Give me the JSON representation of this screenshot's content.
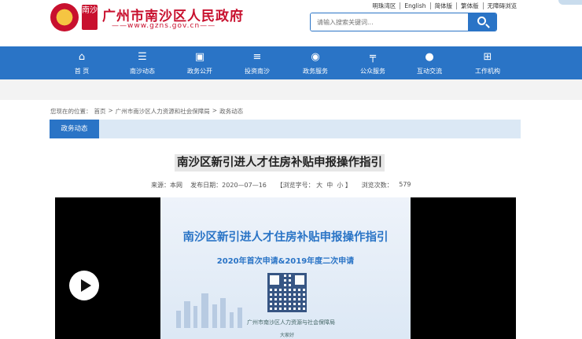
{
  "header": {
    "site_title": "广州市南沙区人民政府",
    "site_url": "——www.gzns.gov.cn——",
    "seal_text": "南沙",
    "top_links": [
      "明珠湾区",
      "English",
      "简体版",
      "繁体版",
      "无障碍浏览"
    ],
    "search_placeholder": "请输入搜索关键词..."
  },
  "nav": {
    "items": [
      {
        "label": "首 页",
        "icon": "home-icon"
      },
      {
        "label": "南沙动态",
        "icon": "list-icon"
      },
      {
        "label": "政务公开",
        "icon": "briefcase-icon"
      },
      {
        "label": "投资南沙",
        "icon": "coins-icon"
      },
      {
        "label": "政务服务",
        "icon": "globe-icon"
      },
      {
        "label": "公众服务",
        "icon": "signpost-icon"
      },
      {
        "label": "互动交流",
        "icon": "chat-icon"
      },
      {
        "label": "工作机构",
        "icon": "org-chart-icon"
      }
    ]
  },
  "breadcrumb": {
    "prefix": "您现在的位置：",
    "items": [
      "首页",
      ">",
      "广州市南沙区人力资源和社会保障局",
      ">",
      "政务动态"
    ]
  },
  "category_tab": "政务动态",
  "article": {
    "title": "南沙区新引进人才住房补贴申报操作指引",
    "meta": {
      "source_label": "来源：本网",
      "date_label": "发布日期：2020—07—16",
      "font_size_label": "【浏览字号： 大  中  小 】",
      "views_label": "浏览次数：",
      "views": "579"
    }
  },
  "video": {
    "frame_title": "南沙区新引进人才住房补贴申报操作指引",
    "frame_subtitle": "2020年首次申请&2019年度二次申请",
    "frame_org": "广州市南沙区人力资源与社会保障局",
    "frame_footer": "大家好"
  },
  "colors": {
    "brand_blue": "#2a74c6",
    "brand_red": "#c8102e"
  }
}
